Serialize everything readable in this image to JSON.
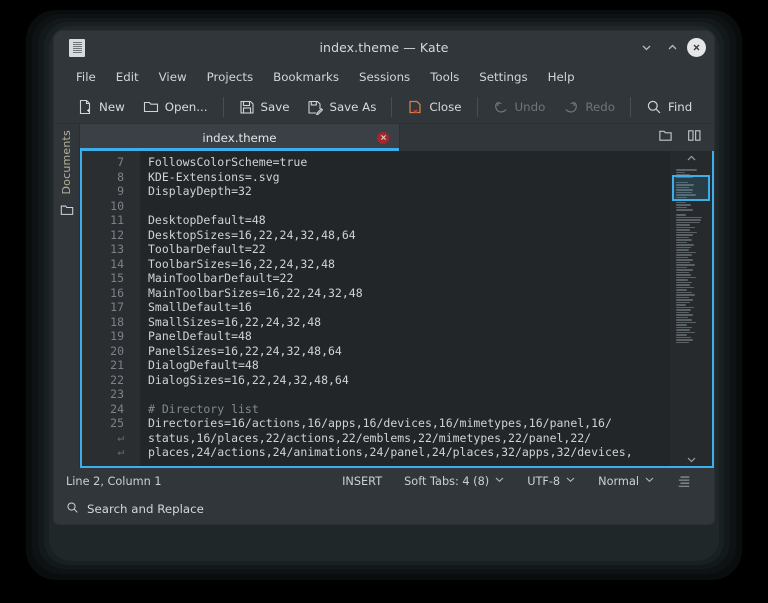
{
  "window": {
    "title": "index.theme — Kate",
    "app_icon": "document-icon",
    "controls": [
      {
        "name": "minimize-button",
        "icon": "chevron-down-icon"
      },
      {
        "name": "maximize-button",
        "icon": "chevron-up-icon"
      },
      {
        "name": "close-button",
        "icon": "close-circle-icon"
      }
    ]
  },
  "menubar": {
    "items": [
      {
        "label": "File"
      },
      {
        "label": "Edit"
      },
      {
        "label": "View"
      },
      {
        "label": "Projects"
      },
      {
        "label": "Bookmarks"
      },
      {
        "label": "Sessions"
      },
      {
        "label": "Tools"
      },
      {
        "label": "Settings"
      },
      {
        "label": "Help"
      }
    ]
  },
  "toolbar": {
    "buttons": [
      {
        "label": "New",
        "icon": "new-document-icon",
        "disabled": false
      },
      {
        "label": "Open...",
        "icon": "folder-open-icon",
        "disabled": false
      },
      {
        "label": "Save",
        "icon": "floppy-disk-icon",
        "disabled": false
      },
      {
        "label": "Save As",
        "icon": "floppy-disk-pencil-icon",
        "disabled": false
      },
      {
        "label": "Close",
        "icon": "close-document-icon",
        "disabled": false
      },
      {
        "label": "Undo",
        "icon": "undo-arrow-icon",
        "disabled": true
      },
      {
        "label": "Redo",
        "icon": "redo-arrow-icon",
        "disabled": true
      },
      {
        "label": "Find",
        "icon": "magnifier-icon",
        "disabled": false
      }
    ]
  },
  "sidebar": {
    "label": "Documents",
    "icon": "folder-icon"
  },
  "tabbar": {
    "tabs": [
      {
        "title": "index.theme",
        "close_icon": "tab-close-icon",
        "active": true
      }
    ],
    "actions": [
      {
        "name": "new-file-icon",
        "icon": "folder-outline-icon"
      },
      {
        "name": "split-view-icon",
        "icon": "split-columns-icon"
      }
    ]
  },
  "editor": {
    "accent_color": "#3daee9",
    "background": "#232629",
    "gutter_background": "#2b2e31",
    "lines": [
      {
        "number": "7",
        "text": "FollowsColorScheme=true",
        "comment": false
      },
      {
        "number": "8",
        "text": "KDE-Extensions=.svg",
        "comment": false
      },
      {
        "number": "9",
        "text": "DisplayDepth=32",
        "comment": false
      },
      {
        "number": "10",
        "text": "",
        "comment": false
      },
      {
        "number": "11",
        "text": "DesktopDefault=48",
        "comment": false
      },
      {
        "number": "12",
        "text": "DesktopSizes=16,22,24,32,48,64",
        "comment": false
      },
      {
        "number": "13",
        "text": "ToolbarDefault=22",
        "comment": false
      },
      {
        "number": "14",
        "text": "ToolbarSizes=16,22,24,32,48",
        "comment": false
      },
      {
        "number": "15",
        "text": "MainToolbarDefault=22",
        "comment": false
      },
      {
        "number": "16",
        "text": "MainToolbarSizes=16,22,24,32,48",
        "comment": false
      },
      {
        "number": "17",
        "text": "SmallDefault=16",
        "comment": false
      },
      {
        "number": "18",
        "text": "SmallSizes=16,22,24,32,48",
        "comment": false
      },
      {
        "number": "19",
        "text": "PanelDefault=48",
        "comment": false
      },
      {
        "number": "20",
        "text": "PanelSizes=16,22,24,32,48,64",
        "comment": false
      },
      {
        "number": "21",
        "text": "DialogDefault=48",
        "comment": false
      },
      {
        "number": "22",
        "text": "DialogSizes=16,22,24,32,48,64",
        "comment": false
      },
      {
        "number": "23",
        "text": "",
        "comment": false
      },
      {
        "number": "24",
        "text": "# Directory list",
        "comment": true
      },
      {
        "number": "25",
        "text": "Directories=16/actions,16/apps,16/devices,16/mimetypes,16/panel,16/",
        "comment": false
      },
      {
        "number": "↵",
        "text": "status,16/places,22/actions,22/emblems,22/mimetypes,22/panel,22/",
        "comment": false
      },
      {
        "number": "↵",
        "text": "places,24/actions,24/animations,24/panel,24/places,32/apps,32/devices,",
        "comment": false
      }
    ]
  },
  "statusbar": {
    "position": "Line 2, Column 1",
    "mode": "INSERT",
    "tabs": "Soft Tabs: 4 (8)",
    "encoding": "UTF-8",
    "highlight": "Normal",
    "align_icon": "text-lines-icon"
  },
  "searchbar": {
    "label": "Search and Replace",
    "icon": "magnifier-icon"
  }
}
